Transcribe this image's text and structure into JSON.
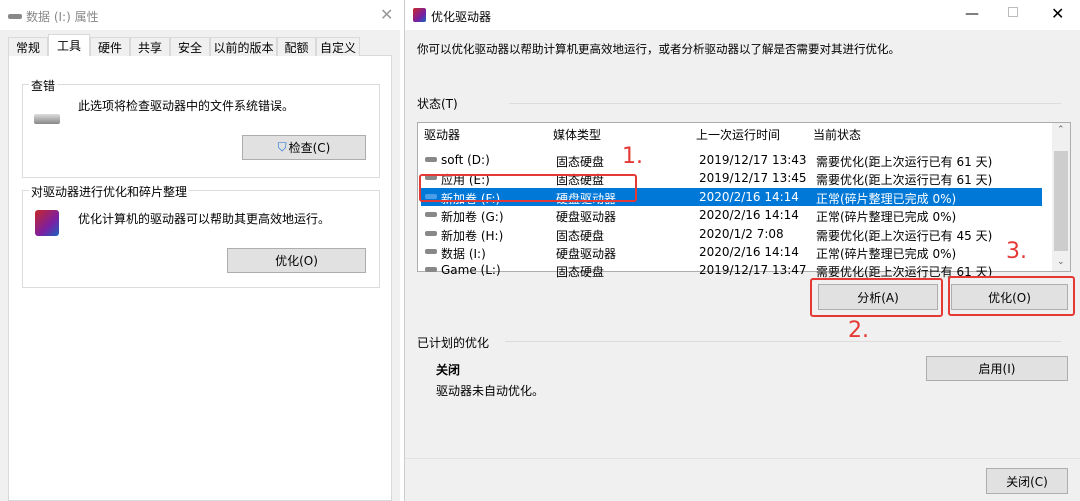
{
  "left": {
    "title": "数据 (I:) 属性",
    "tabs": [
      "常规",
      "工具",
      "硬件",
      "共享",
      "安全",
      "以前的版本",
      "配额",
      "自定义"
    ],
    "check": {
      "label": "查错",
      "desc": "此选项将检查驱动器中的文件系统错误。",
      "button": "检查(C)"
    },
    "optimize": {
      "label": "对驱动器进行优化和碎片整理",
      "desc": "优化计算机的驱动器可以帮助其更高效地运行。",
      "button": "优化(O)"
    }
  },
  "right": {
    "title": "优化驱动器",
    "desc": "你可以优化驱动器以帮助计算机更高效地运行，或者分析驱动器以了解是否需要对其进行优化。",
    "status_label": "状态(T)",
    "columns": [
      "驱动器",
      "媒体类型",
      "上一次运行时间",
      "当前状态"
    ],
    "rows": [
      [
        "soft (D:)",
        "固态硬盘",
        "2019/12/17 13:43",
        "需要优化(距上次运行已有 61 天)"
      ],
      [
        "应用 (E:)",
        "固态硬盘",
        "2019/12/17 13:45",
        "需要优化(距上次运行已有 61 天)"
      ],
      [
        "新加卷 (F:)",
        "硬盘驱动器",
        "2020/2/16 14:14",
        "正常(碎片整理已完成 0%)"
      ],
      [
        "新加卷 (G:)",
        "硬盘驱动器",
        "2020/2/16 14:14",
        "正常(碎片整理已完成 0%)"
      ],
      [
        "新加卷 (H:)",
        "固态硬盘",
        "2020/1/2 7:08",
        "需要优化(距上次运行已有 45 天)"
      ],
      [
        "数据 (I:)",
        "硬盘驱动器",
        "2020/2/16 14:14",
        "正常(碎片整理已完成 0%)"
      ],
      [
        "Game (L:)",
        "固态硬盘",
        "2019/12/17 13:47",
        "需要优化(距上次运行已有 61 天)"
      ]
    ],
    "selected_row": 2,
    "analyze_button": "分析(A)",
    "optimize_button": "优化(O)",
    "scheduled_label": "已计划的优化",
    "scheduled_state": "关闭",
    "scheduled_desc": "驱动器未自动优化。",
    "enable_button": "启用(I)",
    "close_button": "关闭(C)",
    "annotations": [
      "1.",
      "2.",
      "3."
    ],
    "accent": "#0078d7",
    "annotation_color": "#e53935"
  }
}
